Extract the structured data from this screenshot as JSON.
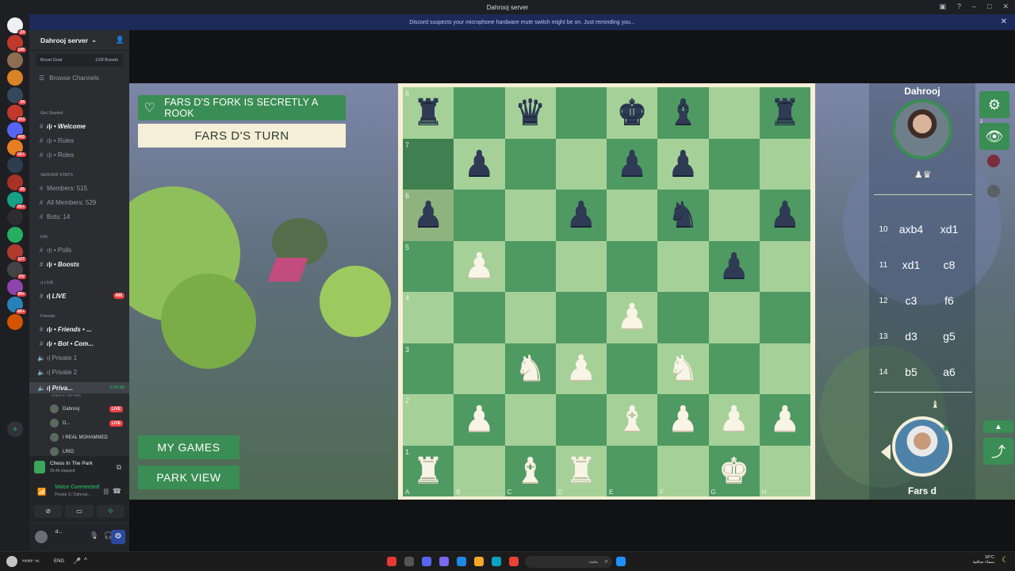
{
  "window": {
    "title": "Dahrooj server"
  },
  "notice": "Discord suspects your microphone hardware mute switch might be on. Just reminding you...",
  "rail": {
    "badges": [
      "24",
      "195",
      "",
      "",
      "34",
      "253",
      "405",
      "1K+",
      "",
      "65",
      "2K+",
      "",
      "",
      "127",
      "OV",
      "99+",
      "4K+",
      ""
    ]
  },
  "sidebar": {
    "server_name": "Dahrooj server",
    "boost_goal": "Boost Goal",
    "boost_count": "1/28 Boosts",
    "browse": "Browse Channels",
    "channels": [
      {
        "label": "Get Started",
        "type": "cat"
      },
      {
        "label": "ı|ı • Welcome",
        "type": "bold"
      },
      {
        "label": "ı|ı • Rules",
        "type": "text"
      },
      {
        "label": "ı|ı • Roles",
        "type": "text"
      },
      {
        "label": "SERVER STATS",
        "type": "cat"
      },
      {
        "label": "Members: 515",
        "type": "text"
      },
      {
        "label": "All Members: 529",
        "type": "text"
      },
      {
        "label": "Bots: 14",
        "type": "text"
      },
      {
        "label": "Info",
        "type": "cat"
      },
      {
        "label": "ı|ı • Polls",
        "type": "text"
      },
      {
        "label": "ı|ı • Boosts",
        "type": "bold"
      },
      {
        "label": "ı| LIVE",
        "type": "cat"
      },
      {
        "label": "ı| LIVE",
        "type": "bold",
        "badge": "498"
      },
      {
        "label": "Friends",
        "type": "cat"
      },
      {
        "label": "ı|ı • Friends • ...",
        "type": "bold"
      },
      {
        "label": "ı|ı • Bot • Com...",
        "type": "bold"
      },
      {
        "label": "ı| Private 1",
        "type": "text"
      },
      {
        "label": "ı| Private 2",
        "type": "text"
      },
      {
        "label": "ı| Priva...",
        "type": "active",
        "timer": "1:24:58"
      }
    ],
    "active_sub": "Chess In The Park",
    "voice_users": [
      {
        "name": "Dahrooj",
        "live": "LIVE"
      },
      {
        "name": "D...",
        "live": "LIVE"
      },
      {
        "name": "I REAL MOHAMMED",
        "live": ""
      },
      {
        "name": "LRIO",
        "live": ""
      }
    ],
    "activity_title": "Chess In The Park",
    "activity_time": "06:46 elapsed",
    "voice_status": "Voice Connected",
    "voice_path": "Private 3 / Dahrooj...",
    "user_short": "d..."
  },
  "game": {
    "banner": "FARS D'S FORK IS SECRETLY A ROOK",
    "turn": "FARS D'S TURN",
    "my_games": "MY GAMES",
    "park_view": "PARK VIEW",
    "board": [
      [
        "bR",
        "",
        "bQ",
        "",
        "bK",
        "bB",
        "",
        "bR"
      ],
      [
        "",
        "bP",
        "",
        "",
        "bP",
        "bP",
        "",
        ""
      ],
      [
        "bP",
        "",
        "",
        "bP",
        "",
        "bN",
        "",
        "bP"
      ],
      [
        "",
        "wP",
        "",
        "",
        "",
        "",
        "bP",
        ""
      ],
      [
        "",
        "",
        "",
        "",
        "wP",
        "",
        "",
        ""
      ],
      [
        "",
        "",
        "wN",
        "wP",
        "",
        "wN",
        "",
        ""
      ],
      [
        "",
        "wP",
        "",
        "",
        "wB",
        "wP",
        "wP",
        "wP"
      ],
      [
        "wR",
        "",
        "wB",
        "wR",
        "",
        "",
        "wK",
        ""
      ]
    ],
    "ranks": [
      "8",
      "7",
      "6",
      "5",
      "4",
      "3",
      "2",
      "1"
    ],
    "files": [
      "A",
      "B",
      "C",
      "D",
      "E",
      "F",
      "G",
      "H"
    ],
    "top_player": "Dahrooj",
    "bottom_player": "Fars d",
    "moves": [
      {
        "n": "10",
        "w": "axb4",
        "b": "xd1"
      },
      {
        "n": "11",
        "w": "xd1",
        "b": "c8"
      },
      {
        "n": "12",
        "w": "c3",
        "b": "f6"
      },
      {
        "n": "13",
        "w": "d3",
        "b": "g5"
      },
      {
        "n": "14",
        "w": "b5",
        "b": "a6"
      }
    ],
    "badge_count": "2"
  },
  "taskbar": {
    "lang": "ENG",
    "search": "بحث",
    "weather": "18°C",
    "weather_sub": "سماء صافية",
    "date": "٢٧/٧/٢٠٢٤",
    "time": "٨:٤٧"
  }
}
